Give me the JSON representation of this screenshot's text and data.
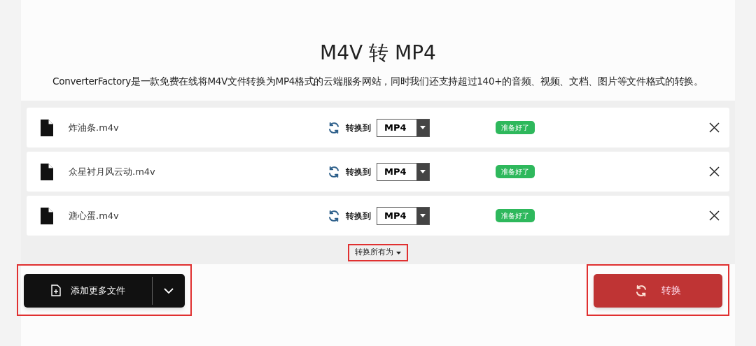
{
  "title": "M4V 转 MP4",
  "description": "ConverterFactory是一款免费在线将M4V文件转换为MP4格式的云端服务网站，同时我们还支持超过140+的音频、视频、文档、图片等文件格式的转换。",
  "files": [
    {
      "name": "炸油条.m4v",
      "convert_label": "转换到",
      "format": "MP4",
      "status": "准备好了"
    },
    {
      "name": "众星衬月风云动.m4v",
      "convert_label": "转换到",
      "format": "MP4",
      "status": "准备好了"
    },
    {
      "name": "溏心蛋.m4v",
      "convert_label": "转换到",
      "format": "MP4",
      "status": "准备好了"
    }
  ],
  "convert_all": {
    "label": "转换所有为",
    "highlighted": true
  },
  "add_files": {
    "label": "添加更多文件",
    "highlighted": true
  },
  "convert_button": {
    "label": "转换",
    "highlighted": true
  }
}
